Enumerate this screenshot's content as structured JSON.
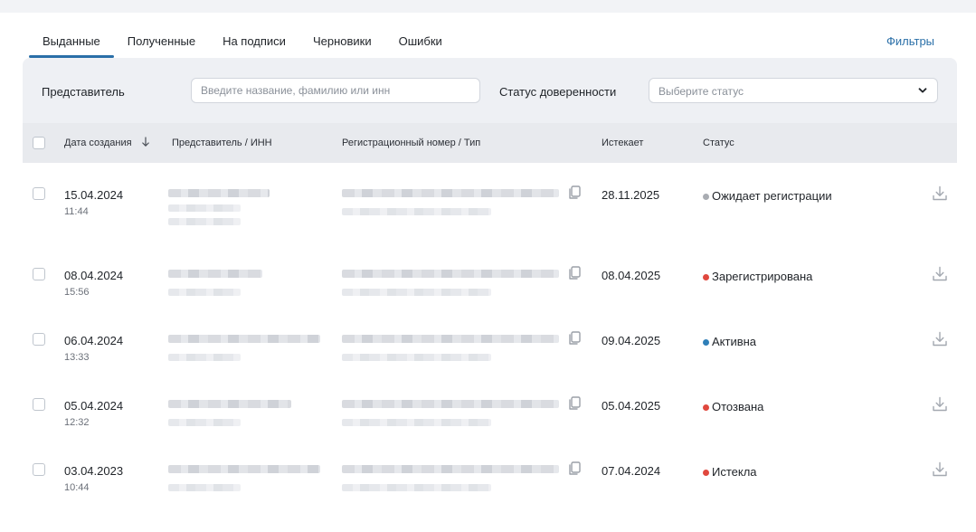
{
  "tabs": [
    {
      "label": "Выданные",
      "active": true
    },
    {
      "label": "Полученные",
      "active": false
    },
    {
      "label": "На подписи",
      "active": false
    },
    {
      "label": "Черновики",
      "active": false
    },
    {
      "label": "Ошибки",
      "active": false
    }
  ],
  "filters_link": "Фильтры",
  "filter": {
    "representative_label": "Представитель",
    "representative_placeholder": "Введите название, фамилию или инн",
    "status_label": "Статус доверенности",
    "status_placeholder": "Выберите статус"
  },
  "table": {
    "headers": {
      "date": "Дата создания",
      "representative": "Представитель / ИНН",
      "reg_number": "Регистрационный номер / Тип",
      "expires": "Истекает",
      "status": "Статус"
    },
    "rows": [
      {
        "date": "15.04.2024",
        "time": "11:44",
        "expires": "28.11.2025",
        "status": "Ожидает регистрации",
        "status_color": "#a9acb2"
      },
      {
        "date": "08.04.2024",
        "time": "15:56",
        "expires": "08.04.2025",
        "status": "Зарегистрирована",
        "status_color": "#e0483e"
      },
      {
        "date": "06.04.2024",
        "time": "13:33",
        "expires": "09.04.2025",
        "status": "Активна",
        "status_color": "#2f7fb8"
      },
      {
        "date": "05.04.2024",
        "time": "12:32",
        "expires": "05.04.2025",
        "status": "Отозвана",
        "status_color": "#e0483e"
      },
      {
        "date": "03.04.2023",
        "time": "10:44",
        "expires": "07.04.2024",
        "status": "Истекла",
        "status_color": "#e0483e"
      }
    ]
  },
  "colors": {
    "accent": "#2a6fa8",
    "panel_bg": "#eef0f4",
    "header_bg": "#e8eaee"
  },
  "icons": {
    "sort": "arrow-down-icon",
    "copy": "copy-icon",
    "download": "download-icon",
    "select_chevron": "chevron-down-icon"
  }
}
